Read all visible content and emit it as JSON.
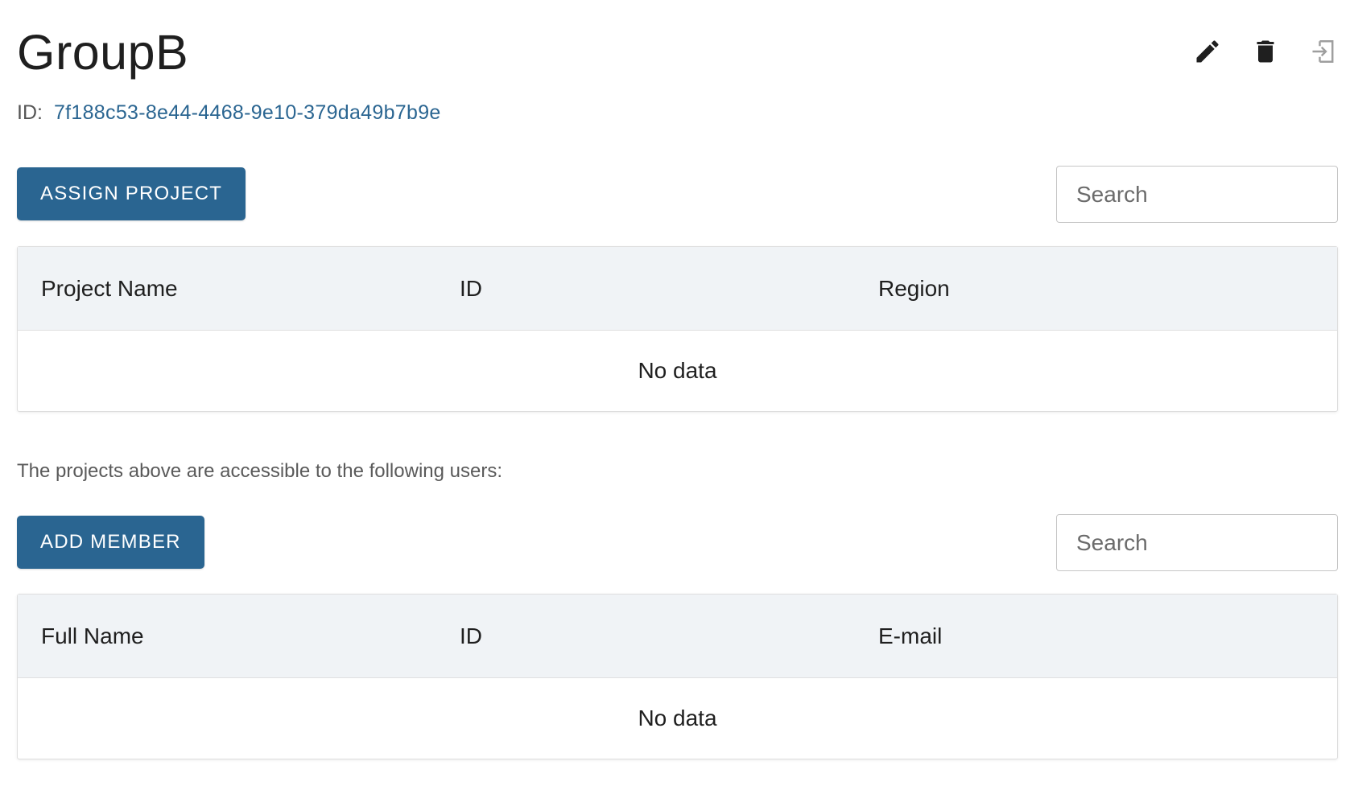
{
  "group": {
    "title": "GroupB",
    "id_label": "ID:",
    "id_value": "7f188c53-8e44-4468-9e10-379da49b7b9e"
  },
  "icons": [
    "edit-icon",
    "delete-icon",
    "leave-icon"
  ],
  "projects": {
    "button_label": "ASSIGN PROJECT",
    "search_placeholder": "Search",
    "columns": [
      "Project Name",
      "ID",
      "Region"
    ],
    "empty_text": "No data"
  },
  "access_note": "The projects above are accessible to the following users:",
  "members": {
    "button_label": "ADD MEMBER",
    "search_placeholder": "Search",
    "columns": [
      "Full Name",
      "ID",
      "E-mail"
    ],
    "empty_text": "No data"
  },
  "colors": {
    "primary": "#2a6591",
    "table_header_bg": "#f0f3f6",
    "text": "#1f1f1f"
  }
}
